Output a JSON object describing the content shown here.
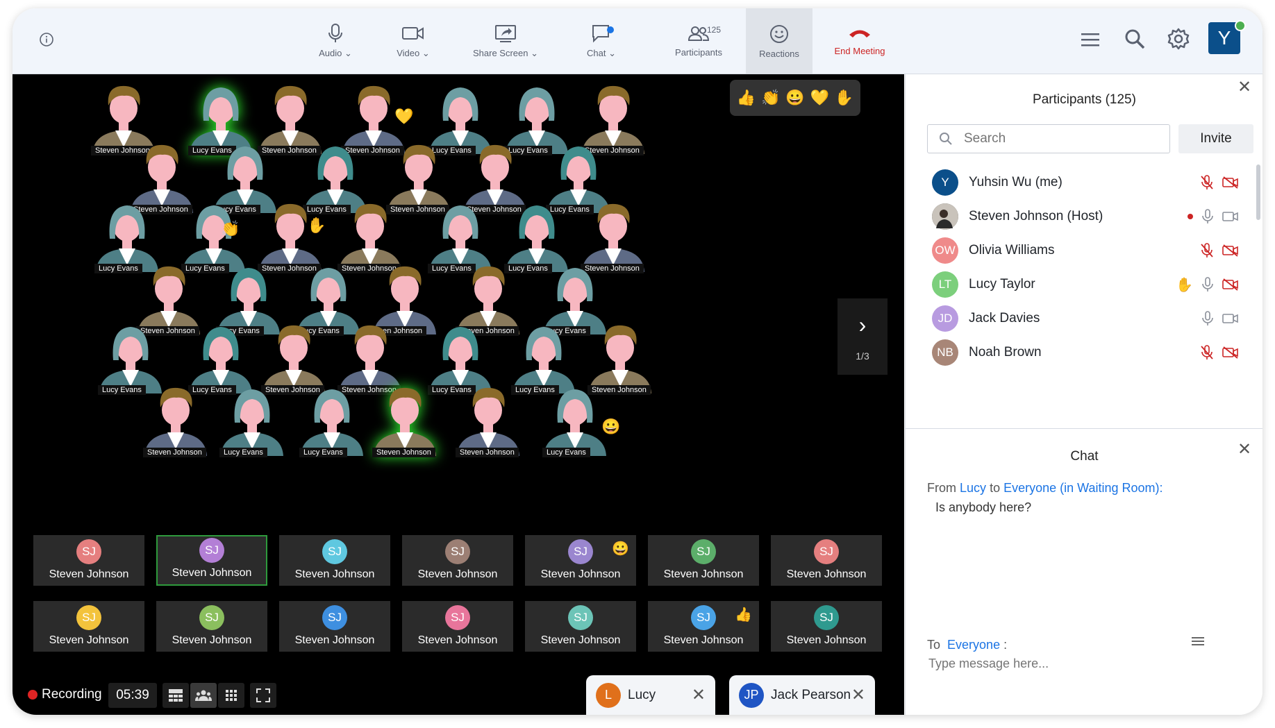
{
  "toolbar": {
    "audio_label": "Audio",
    "video_label": "Video",
    "share_label": "Share Screen",
    "chat_label": "Chat",
    "participants_label": "Participants",
    "participants_count": "125",
    "reactions_label": "Reactions",
    "end_label": "End Meeting",
    "user_initial": "Y"
  },
  "stage": {
    "reactions": [
      "👍",
      "👏",
      "😀",
      "💛",
      "✋"
    ],
    "gallery_names": [
      "Steven Johnson",
      "Lucy Evans",
      "Steven Johnson",
      "Steven Johnson",
      "Lucy Evans",
      "Lucy Evans",
      "Steven Johnson",
      "Steven Johnson",
      "Lucy Evans",
      "Lucy Evans",
      "Steven Johnson",
      "Steven Johnson",
      "Lucy Evans",
      "Lucy Evans",
      "Lucy Evans",
      "Steven Johnson",
      "Steven Johnson",
      "Lucy Evans",
      "Lucy Evans",
      "Steven Johnson",
      "Steven Johnson",
      "Lucy Evans",
      "Lucy Evans",
      "...en Johnson",
      "Steven Johnson",
      "Lucy Evans",
      "Lucy Evans",
      "Lucy Evans",
      "Steven Johnson",
      "Steven Johnson",
      "Lucy Evans",
      "Lucy Evans",
      "Steven Johnson",
      "Steven Johnson",
      "Lucy Evans",
      "Lucy Evans",
      "Steven Johnson",
      "Steven Johnson",
      "Lucy Evans"
    ],
    "pager_label": "1/3",
    "tiles": [
      {
        "initials": "SJ",
        "name": "Steven Johnson",
        "color": "#e57f7f"
      },
      {
        "initials": "SJ",
        "name": "Steven Johnson",
        "color": "#b37fd6"
      },
      {
        "initials": "SJ",
        "name": "Steven Johnson",
        "color": "#5fc8e0"
      },
      {
        "initials": "SJ",
        "name": "Steven Johnson",
        "color": "#9c7f74"
      },
      {
        "initials": "SJ",
        "name": "Steven Johnson",
        "color": "#9a86cf",
        "emoji": "😀"
      },
      {
        "initials": "SJ",
        "name": "Steven Johnson",
        "color": "#5cae6a"
      },
      {
        "initials": "SJ",
        "name": "Steven Johnson",
        "color": "#e57f7f"
      },
      {
        "initials": "SJ",
        "name": "Steven Johnson",
        "color": "#f3c33c"
      },
      {
        "initials": "SJ",
        "name": "Steven Johnson",
        "color": "#8bbf5e"
      },
      {
        "initials": "SJ",
        "name": "Steven Johnson",
        "color": "#3e8fe0"
      },
      {
        "initials": "SJ",
        "name": "Steven Johnson",
        "color": "#e8759b"
      },
      {
        "initials": "SJ",
        "name": "Steven Johnson",
        "color": "#6cc4b7"
      },
      {
        "initials": "SJ",
        "name": "Steven Johnson",
        "color": "#4aa3e6",
        "emoji": "👍"
      },
      {
        "initials": "SJ",
        "name": "Steven Johnson",
        "color": "#2f9a8f"
      }
    ],
    "recording_label": "Recording",
    "timer": "05:39",
    "chat_tabs": [
      {
        "initial": "L",
        "name": "Lucy",
        "color": "#e0701b"
      },
      {
        "initial": "JP",
        "name": "Jack Pearson",
        "color": "#1f55c4"
      }
    ]
  },
  "participants_panel": {
    "title": "Participants (125)",
    "search_placeholder": "Search",
    "invite_label": "Invite",
    "people": [
      {
        "initials": "Y",
        "name": "Yuhsin Wu (me)",
        "color": "#0b4f8a",
        "mic": "muted",
        "cam": "off"
      },
      {
        "initials": "",
        "name": "Steven Johnson (Host)",
        "color": "#3a3a3a",
        "mic": "on",
        "cam": "on",
        "recording": true
      },
      {
        "initials": "OW",
        "name": "Olivia Williams",
        "color": "#ef8a8a",
        "mic": "muted",
        "cam": "off"
      },
      {
        "initials": "LT",
        "name": "Lucy Taylor",
        "color": "#7ccf7c",
        "mic": "on",
        "cam": "off",
        "hand": true
      },
      {
        "initials": "JD",
        "name": "Jack Davies",
        "color": "#b89be0",
        "mic": "on",
        "cam": "on"
      },
      {
        "initials": "NB",
        "name": "Noah Brown",
        "color": "#a88677",
        "mic": "muted",
        "cam": "off"
      }
    ]
  },
  "chat_panel": {
    "title": "Chat",
    "from_prefix": "From",
    "from_sender": "Lucy",
    "from_to": "to",
    "from_target": "Everyone (in Waiting Room):",
    "message": "Is anybody here?",
    "to_prefix": "To",
    "to_target": "Everyone",
    "to_suffix": ":",
    "input_placeholder": "Type message here..."
  },
  "colors": {
    "accent": "#1b74e4",
    "danger": "#cc2424",
    "speaking": "#2e9a3c"
  }
}
